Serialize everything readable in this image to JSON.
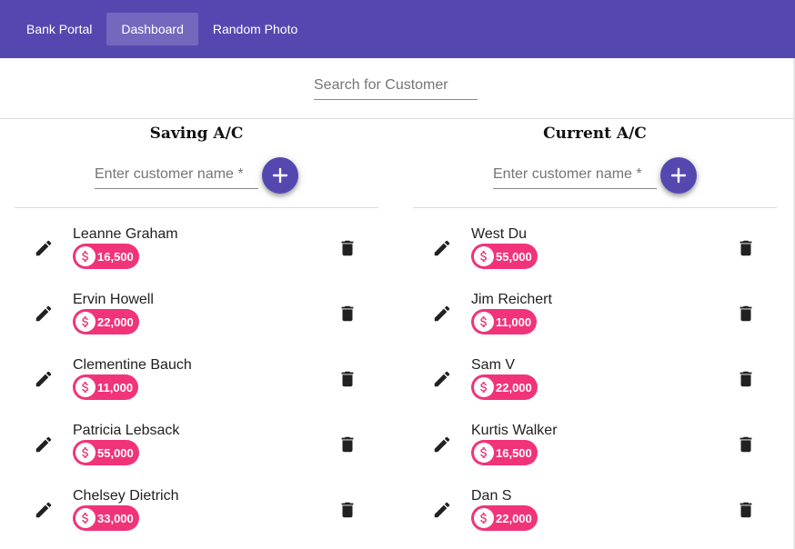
{
  "appbar": {
    "brand": "Bank Portal",
    "tabs": [
      {
        "label": "Dashboard",
        "active": true
      },
      {
        "label": "Random Photo",
        "active": false
      }
    ]
  },
  "search": {
    "placeholder": "Search for Customer",
    "value": ""
  },
  "saving": {
    "title": "Saving A/C",
    "input_placeholder": "Enter customer name *",
    "customers": [
      {
        "name": "Leanne Graham",
        "balance": "16,500"
      },
      {
        "name": "Ervin Howell",
        "balance": "22,000"
      },
      {
        "name": "Clementine Bauch",
        "balance": "11,000"
      },
      {
        "name": "Patricia Lebsack",
        "balance": "55,000"
      },
      {
        "name": "Chelsey Dietrich",
        "balance": "33,000"
      }
    ]
  },
  "current": {
    "title": "Current A/C",
    "input_placeholder": "Enter customer name *",
    "customers": [
      {
        "name": "West Du",
        "balance": "55,000"
      },
      {
        "name": "Jim Reichert",
        "balance": "11,000"
      },
      {
        "name": "Sam V",
        "balance": "22,000"
      },
      {
        "name": "Kurtis Walker",
        "balance": "16,500"
      },
      {
        "name": "Dan S",
        "balance": "22,000"
      }
    ]
  },
  "icons": {
    "add": "plus-icon",
    "edit": "pencil-icon",
    "delete": "trash-icon",
    "balance": "dollar-icon"
  },
  "colors": {
    "primary": "#5448b0",
    "chip": "#f1337a"
  }
}
